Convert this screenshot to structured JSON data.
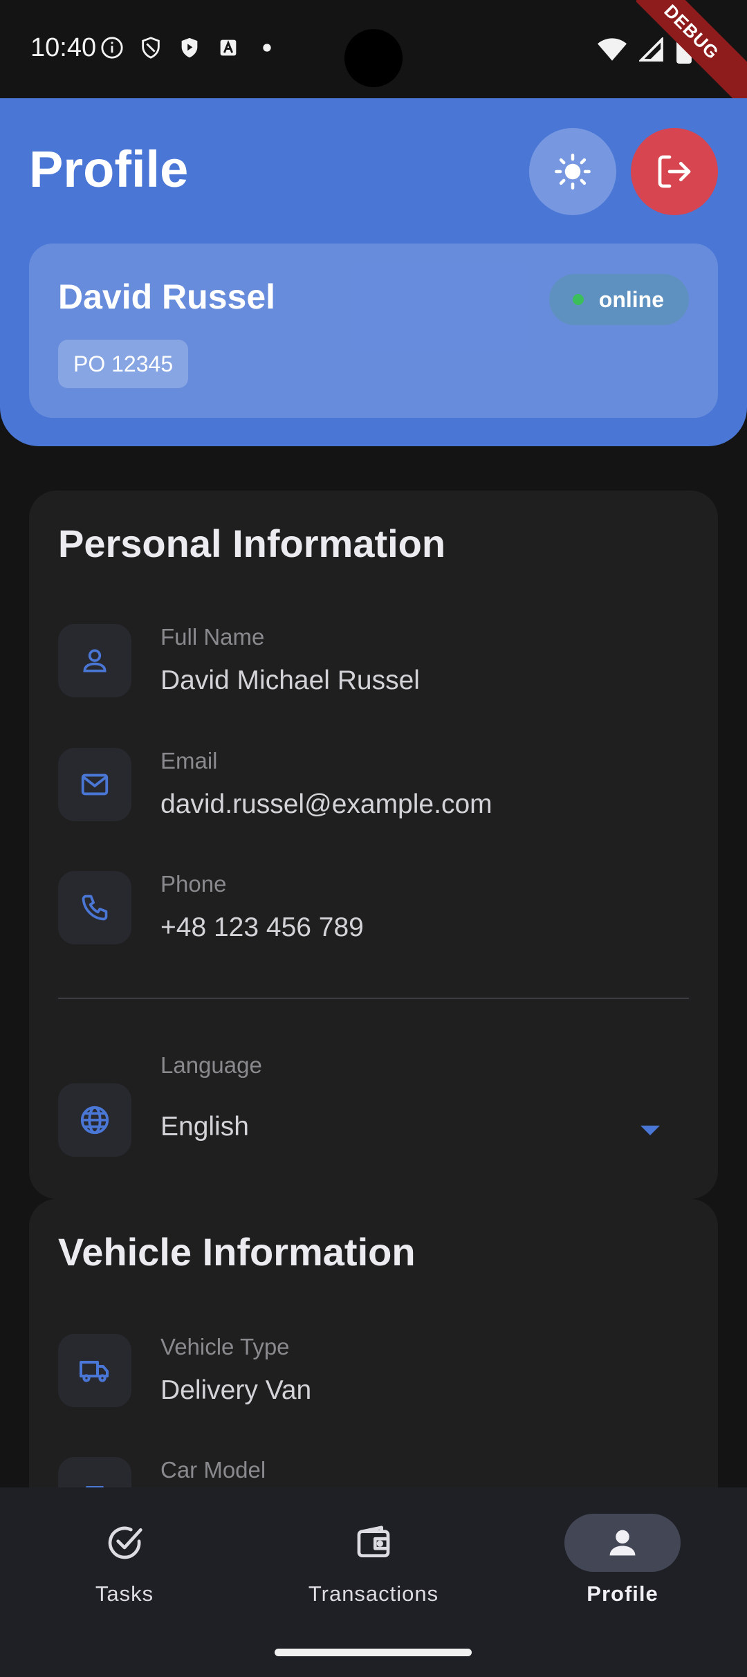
{
  "status_bar": {
    "time": "10:40",
    "debug_label": "DEBUG"
  },
  "header": {
    "title": "Profile",
    "theme_icon": "sun-icon",
    "logout_icon": "logout-icon"
  },
  "user": {
    "name": "David Russel",
    "status": "online",
    "status_color": "#3bbf5a",
    "po_number": "PO 12345"
  },
  "personal": {
    "title": "Personal Information",
    "rows": [
      {
        "label": "Full Name",
        "value": "David Michael Russel",
        "icon": "person-icon"
      },
      {
        "label": "Email",
        "value": "david.russel@example.com",
        "icon": "mail-icon"
      },
      {
        "label": "Phone",
        "value": "+48 123 456 789",
        "icon": "phone-icon"
      }
    ],
    "language": {
      "label": "Language",
      "value": "English",
      "icon": "globe-icon"
    }
  },
  "vehicle": {
    "title": "Vehicle Information",
    "rows": [
      {
        "label": "Vehicle Type",
        "value": "Delivery Van",
        "icon": "truck-icon"
      },
      {
        "label": "Car Model",
        "value": "",
        "icon": "car-icon"
      }
    ]
  },
  "nav": {
    "items": [
      {
        "label": "Tasks",
        "icon": "check-circle-icon"
      },
      {
        "label": "Transactions",
        "icon": "wallet-icon"
      },
      {
        "label": "Profile",
        "icon": "person-icon"
      }
    ],
    "active": "Profile"
  },
  "colors": {
    "accent": "#4a76d6",
    "logout": "#d64550",
    "background": "#141414",
    "card": "#1f1f20"
  }
}
